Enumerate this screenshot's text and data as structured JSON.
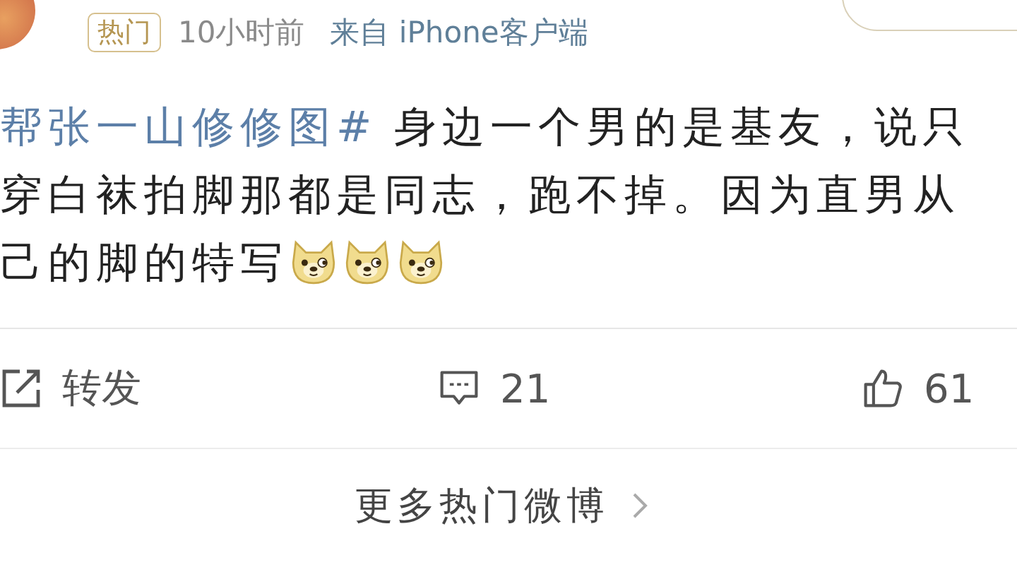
{
  "meta": {
    "hot_badge": "热门",
    "time": "10小时前",
    "source": "来自 iPhone客户端"
  },
  "post_lines": [
    {
      "segments": [
        {
          "kind": "topic",
          "text": "帮张一山修修图#"
        },
        {
          "kind": "plain",
          "text": "身边一个男的是基友，说只"
        }
      ]
    },
    {
      "segments": [
        {
          "kind": "plain",
          "text": "穿白袜拍脚那都是同志，跑不掉。因为直男从"
        }
      ]
    },
    {
      "segments": [
        {
          "kind": "plain",
          "text": "己的脚的特写"
        },
        {
          "kind": "emoji"
        },
        {
          "kind": "emoji"
        },
        {
          "kind": "emoji"
        }
      ]
    }
  ],
  "actions": [
    {
      "kind": "repost",
      "label": "转发"
    },
    {
      "kind": "comment",
      "label": "21"
    },
    {
      "kind": "like",
      "label": "61"
    }
  ],
  "more_link": "更多热门微博"
}
